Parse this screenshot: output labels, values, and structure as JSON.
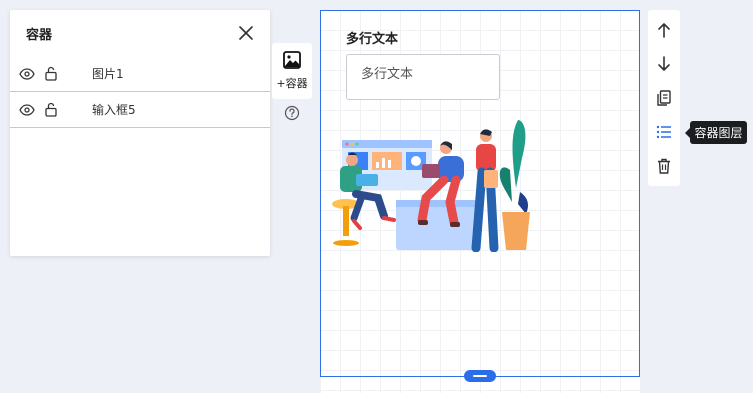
{
  "layer_panel": {
    "title": "容器",
    "close_icon": "close-icon",
    "items": [
      {
        "name": "图片1",
        "visibility_icon": "eye-icon",
        "lock_icon": "unlock-icon"
      },
      {
        "name": "输入框5",
        "visibility_icon": "eye-icon",
        "lock_icon": "unlock-icon"
      }
    ]
  },
  "add_container": {
    "icon": "image-icon",
    "label": "+容器",
    "help_icon": "question-circle-icon"
  },
  "canvas": {
    "text_label": "多行文本",
    "textarea_value": "多行文本",
    "illustration": "team-dashboard-illustration",
    "accent_color": "#2b6de8"
  },
  "right_toolbar": {
    "buttons": [
      {
        "icon": "arrow-up-icon",
        "label": ""
      },
      {
        "icon": "arrow-down-icon",
        "label": ""
      },
      {
        "icon": "copy-icon",
        "label": ""
      },
      {
        "icon": "list-icon",
        "label": "容器图层",
        "active": true
      },
      {
        "icon": "trash-icon",
        "label": ""
      }
    ],
    "tooltip": "容器图层"
  }
}
